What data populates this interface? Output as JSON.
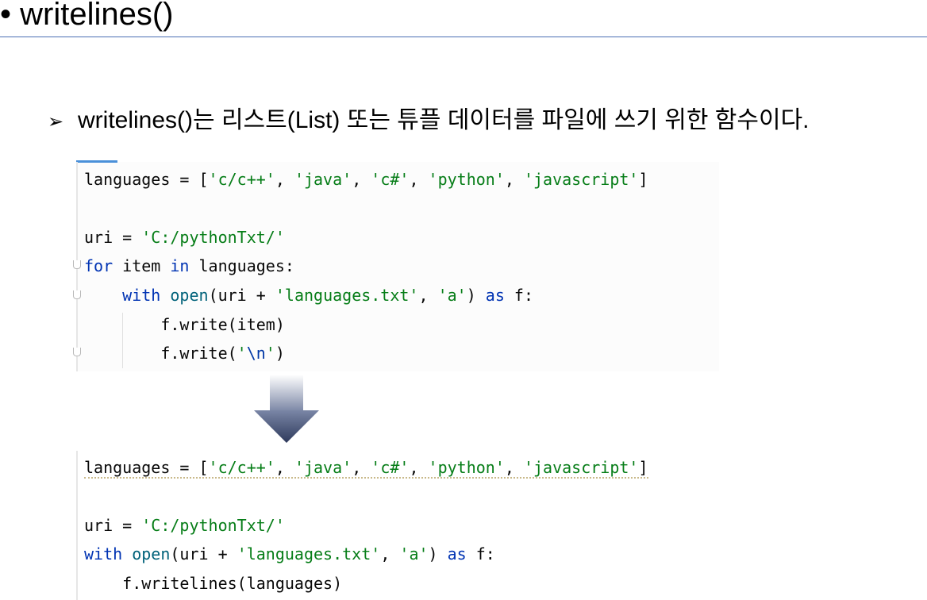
{
  "title": "• writelines()",
  "bullet": {
    "marker": "➢",
    "text": "writelines()는 리스트(List) 또는 튜플 데이터를 파일에 쓰기 위한 함수이다."
  },
  "code_before": {
    "l1": {
      "a": "languages = [",
      "s1": "'c/c++'",
      "c1": ", ",
      "s2": "'java'",
      "c2": ", ",
      "s3": "'c#'",
      "c3": ", ",
      "s4": "'python'",
      "c4": ", ",
      "s5": "'javascript'",
      "end": "]"
    },
    "l2": {
      "a": "uri = ",
      "s": "'C:/pythonTxt/'"
    },
    "l3": {
      "kw1": "for",
      "a": " item ",
      "kw2": "in",
      "b": " languages:"
    },
    "l4": {
      "indent": "    ",
      "kw1": "with",
      "sp": " ",
      "fn": "open",
      "a": "(uri + ",
      "s1": "'languages.txt'",
      "c": ", ",
      "s2": "'a'",
      "b": ") ",
      "kw2": "as",
      "d": " f:"
    },
    "l5": {
      "text": "        f.write(item)"
    },
    "l6": {
      "a": "        f.write(",
      "q1": "'",
      "esc": "\\n",
      "q2": "'",
      "b": ")"
    }
  },
  "code_after": {
    "l1": {
      "a": "languages = [",
      "s1": "'c/c++'",
      "c1": ", ",
      "s2": "'java'",
      "c2": ", ",
      "s3": "'c#'",
      "c3": ", ",
      "s4": "'python'",
      "c4": ", ",
      "s5": "'javascript'",
      "end": "]"
    },
    "l2": {
      "a": "uri = ",
      "s": "'C:/pythonTxt/'"
    },
    "l3": {
      "kw1": "with",
      "sp": " ",
      "fn": "open",
      "a": "(uri + ",
      "s1": "'languages.txt'",
      "c": ", ",
      "s2": "'a'",
      "b": ") ",
      "kw2": "as",
      "d": " f:"
    },
    "l4": {
      "text": "    f.writelines(languages)"
    }
  },
  "colors": {
    "keyword": "#0033b3",
    "string": "#067d17",
    "function": "#00627a",
    "rule": "#4a6fb3"
  }
}
